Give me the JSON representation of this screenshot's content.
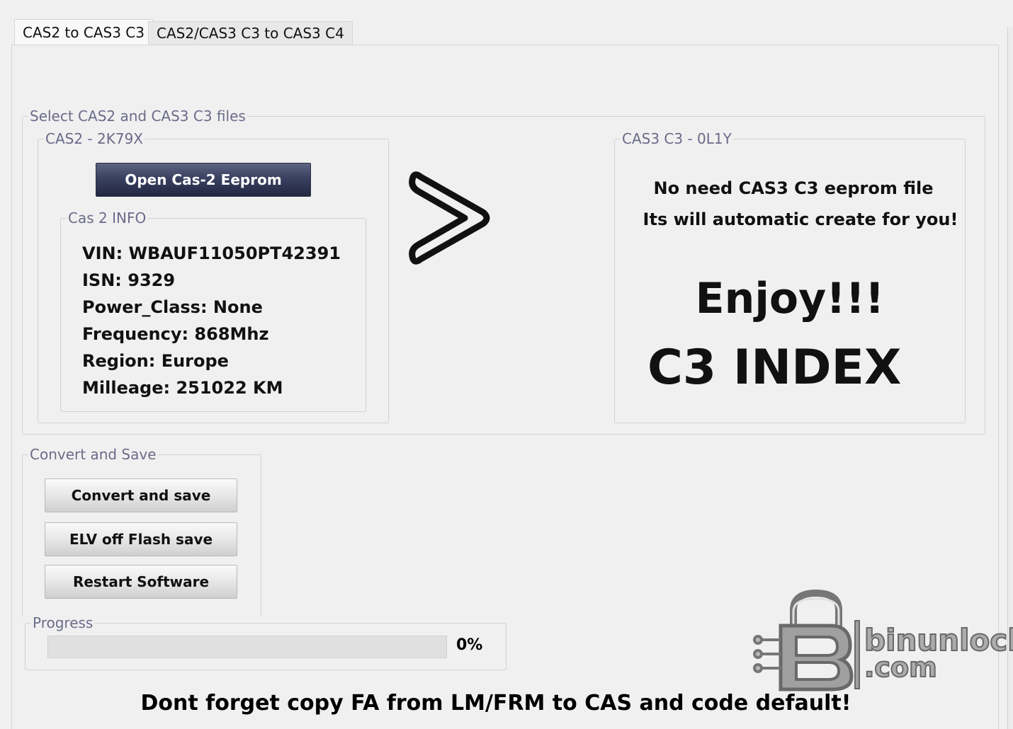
{
  "tabs": [
    {
      "label": "CAS2 to CAS3 C3",
      "active": true
    },
    {
      "label": "CAS2/CAS3 C3 to CAS3 C4",
      "active": false
    }
  ],
  "select_group": {
    "legend": "Select CAS2 and CAS3 C3 files",
    "cas2": {
      "legend": "CAS2 - 2K79X",
      "open_button": "Open Cas-2 Eeprom",
      "info": {
        "legend": "Cas 2 INFO",
        "lines": [
          "VIN: WBAUF11050PT42391",
          "ISN: 9329",
          "Power_Class:  None",
          "Frequency:  868Mhz",
          "Region:  Europe",
          "Milleage: 251022 KM"
        ]
      }
    },
    "arrow_icon": "chevron-right-icon",
    "cas3": {
      "legend": "CAS3 C3 - 0L1Y",
      "line1": "No need CAS3 C3 eeprom file",
      "line2": "Its will automatic create for you!",
      "enjoy": "Enjoy!!!",
      "index": "C3 INDEX"
    }
  },
  "convert_group": {
    "legend": "Convert and Save",
    "buttons": [
      "Convert and save",
      "ELV off Flash save",
      "Restart Software"
    ]
  },
  "progress": {
    "legend": "Progress",
    "value": 0,
    "label": "0%"
  },
  "footer_note": "Dont forget copy FA from LM/FRM to CAS and code default!",
  "watermark": {
    "icon": "padlock-b-logo-icon",
    "line1": "binunlock",
    "line2": ".com"
  },
  "colors": {
    "dark_button": "#2f3550",
    "legend_text": "#6b6b8a",
    "background": "#f0f0f0"
  }
}
